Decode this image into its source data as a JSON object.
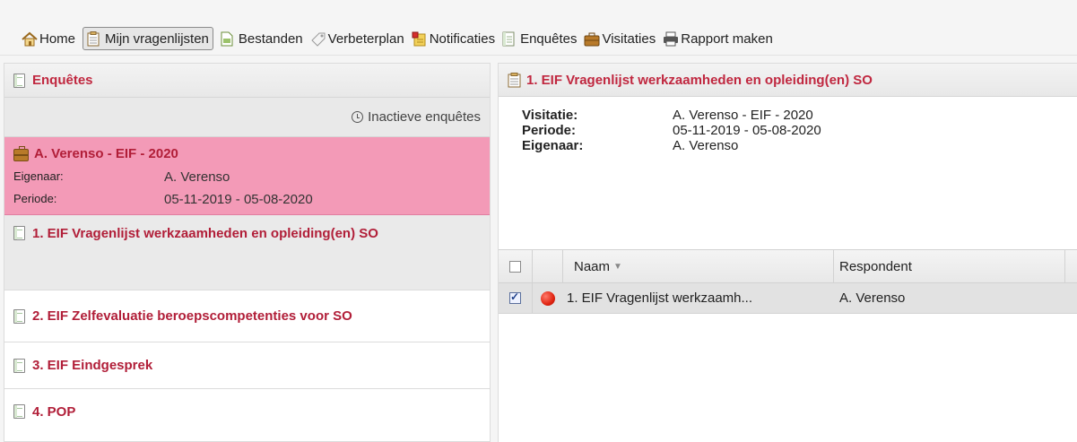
{
  "toolbar": {
    "items": [
      {
        "label": "Home",
        "icon": "home-icon"
      },
      {
        "label": "Mijn vragenlijsten",
        "icon": "document-icon",
        "active": true
      },
      {
        "label": "Bestanden",
        "icon": "file-icon"
      },
      {
        "label": "Verbeterplan",
        "icon": "tag-icon"
      },
      {
        "label": "Notificaties",
        "icon": "notification-icon"
      },
      {
        "label": "Enquêtes",
        "icon": "document-icon"
      },
      {
        "label": "Visitaties",
        "icon": "briefcase-icon"
      },
      {
        "label": "Rapport maken",
        "icon": "printer-icon"
      }
    ]
  },
  "left": {
    "header": "Enquêtes",
    "inactive_link": "Inactieve enquêtes",
    "visit": {
      "title": "A. Verenso - EIF - 2020",
      "owner_label": "Eigenaar:",
      "owner": "A. Verenso",
      "period_label": "Periode:",
      "period": "05-11-2019 - 05-08-2020"
    },
    "items": [
      {
        "label": "1. EIF Vragenlijst werkzaamheden en opleiding(en) SO",
        "selected": true
      },
      {
        "label": "2. EIF Zelfevaluatie beroepscompetenties voor SO"
      },
      {
        "label": "3. EIF Eindgesprek"
      },
      {
        "label": "4. POP"
      }
    ]
  },
  "right": {
    "header": "1. EIF Vragenlijst werkzaamheden en opleiding(en) SO",
    "info": [
      {
        "key": "Visitatie:",
        "value": "A. Verenso - EIF - 2020"
      },
      {
        "key": "Periode:",
        "value": "05-11-2019 - 05-08-2020"
      },
      {
        "key": "Eigenaar:",
        "value": "A. Verenso"
      }
    ],
    "grid": {
      "columns": [
        "Naam",
        "Respondent"
      ],
      "rows": [
        {
          "checked": true,
          "status_color": "#e02411",
          "name": "1. EIF Vragenlijst werkzaamh...",
          "respondent": "A. Verenso"
        }
      ]
    }
  },
  "colors": {
    "accent": "#c0273f",
    "visit_bg": "#f39ab7"
  }
}
